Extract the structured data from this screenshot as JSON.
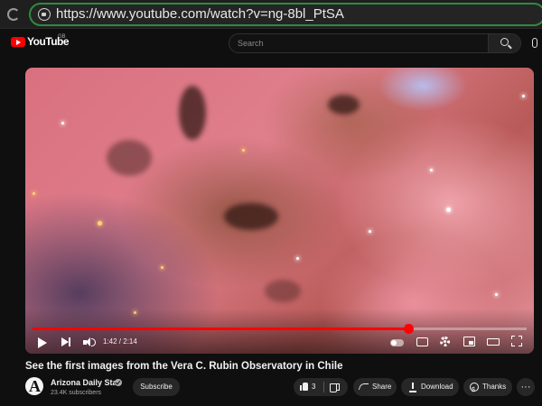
{
  "browser": {
    "url": "https://www.youtube.com/watch?v=ng-8bl_PtSA"
  },
  "header": {
    "logo_text": "YouTube",
    "region": "GB",
    "search_placeholder": "Search"
  },
  "player": {
    "time_display": "1:42 / 2:14",
    "progress_fraction": 0.76,
    "autoplay": "on"
  },
  "video": {
    "title": "See the first images from the Vera C. Rubin Observatory in Chile"
  },
  "channel": {
    "name": "Arizona Daily Star",
    "subscribers": "23.4K subscribers",
    "subscribe_label": "Subscribe"
  },
  "actions": {
    "like_count": "3",
    "share_label": "Share",
    "download_label": "Download",
    "thanks_label": "Thanks",
    "more_label": "···"
  },
  "colors": {
    "accent": "#ff0000",
    "url_border": "#2e8b3e",
    "background": "#0f0f0f"
  }
}
